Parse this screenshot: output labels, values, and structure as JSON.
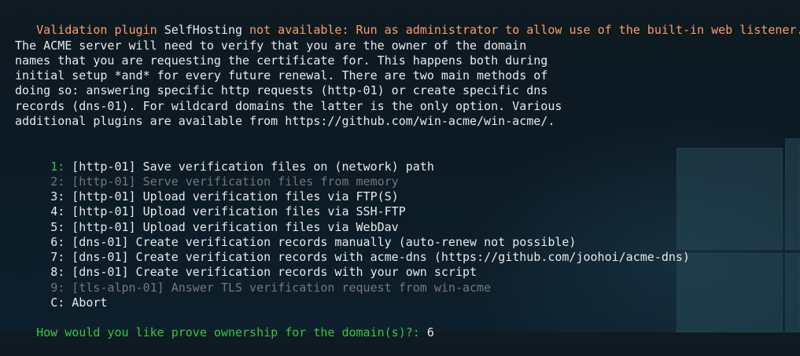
{
  "terminal": {
    "warning": {
      "part1": "Validation plugin ",
      "plugin_name": "SelfHosting",
      "part2": " not available: ",
      "reason": "Run as administrator to allow use of the built-in web listener."
    },
    "description_lines": [
      " The ACME server will need to verify that you are the owner of the domain",
      " names that you are requesting the certificate for. This happens both during",
      " initial setup *and* for every future renewal. There are two main methods of",
      " doing so: answering specific http requests (http-01) or create specific dns",
      " records (dns-01). For wildcard domains the latter is the only option. Various",
      " additional plugins are available from https://github.com/win-acme/win-acme/."
    ],
    "options": [
      {
        "key": "1: ",
        "label": "[http-01] Save verification files on (network) path",
        "state": "selected-green"
      },
      {
        "key": "2: ",
        "label": "[http-01] Serve verification files from memory",
        "state": "disabled"
      },
      {
        "key": "3: ",
        "label": "[http-01] Upload verification files via FTP(S)",
        "state": "normal"
      },
      {
        "key": "4: ",
        "label": "[http-01] Upload verification files via SSH-FTP",
        "state": "normal"
      },
      {
        "key": "5: ",
        "label": "[http-01] Upload verification files via WebDav",
        "state": "normal"
      },
      {
        "key": "6: ",
        "label": "[dns-01] Create verification records manually (auto-renew not possible)",
        "state": "normal"
      },
      {
        "key": "7: ",
        "label": "[dns-01] Create verification records with acme-dns (https://github.com/joohoi/acme-dns)",
        "state": "normal"
      },
      {
        "key": "8: ",
        "label": "[dns-01] Create verification records with your own script",
        "state": "normal"
      },
      {
        "key": "9: ",
        "label": "[tls-alpn-01] Answer TLS verification request from win-acme",
        "state": "disabled"
      },
      {
        "key": "C: ",
        "label": "Abort",
        "state": "normal"
      }
    ],
    "prompt": "How would you like prove ownership for the domain(s)?: ",
    "answer": "6"
  },
  "colors": {
    "warning_orange": "#ff9b63",
    "prompt_green": "#32c83d",
    "disabled_gray": "#767676",
    "text": "#e9e9e9",
    "background": "#0f1a22"
  }
}
